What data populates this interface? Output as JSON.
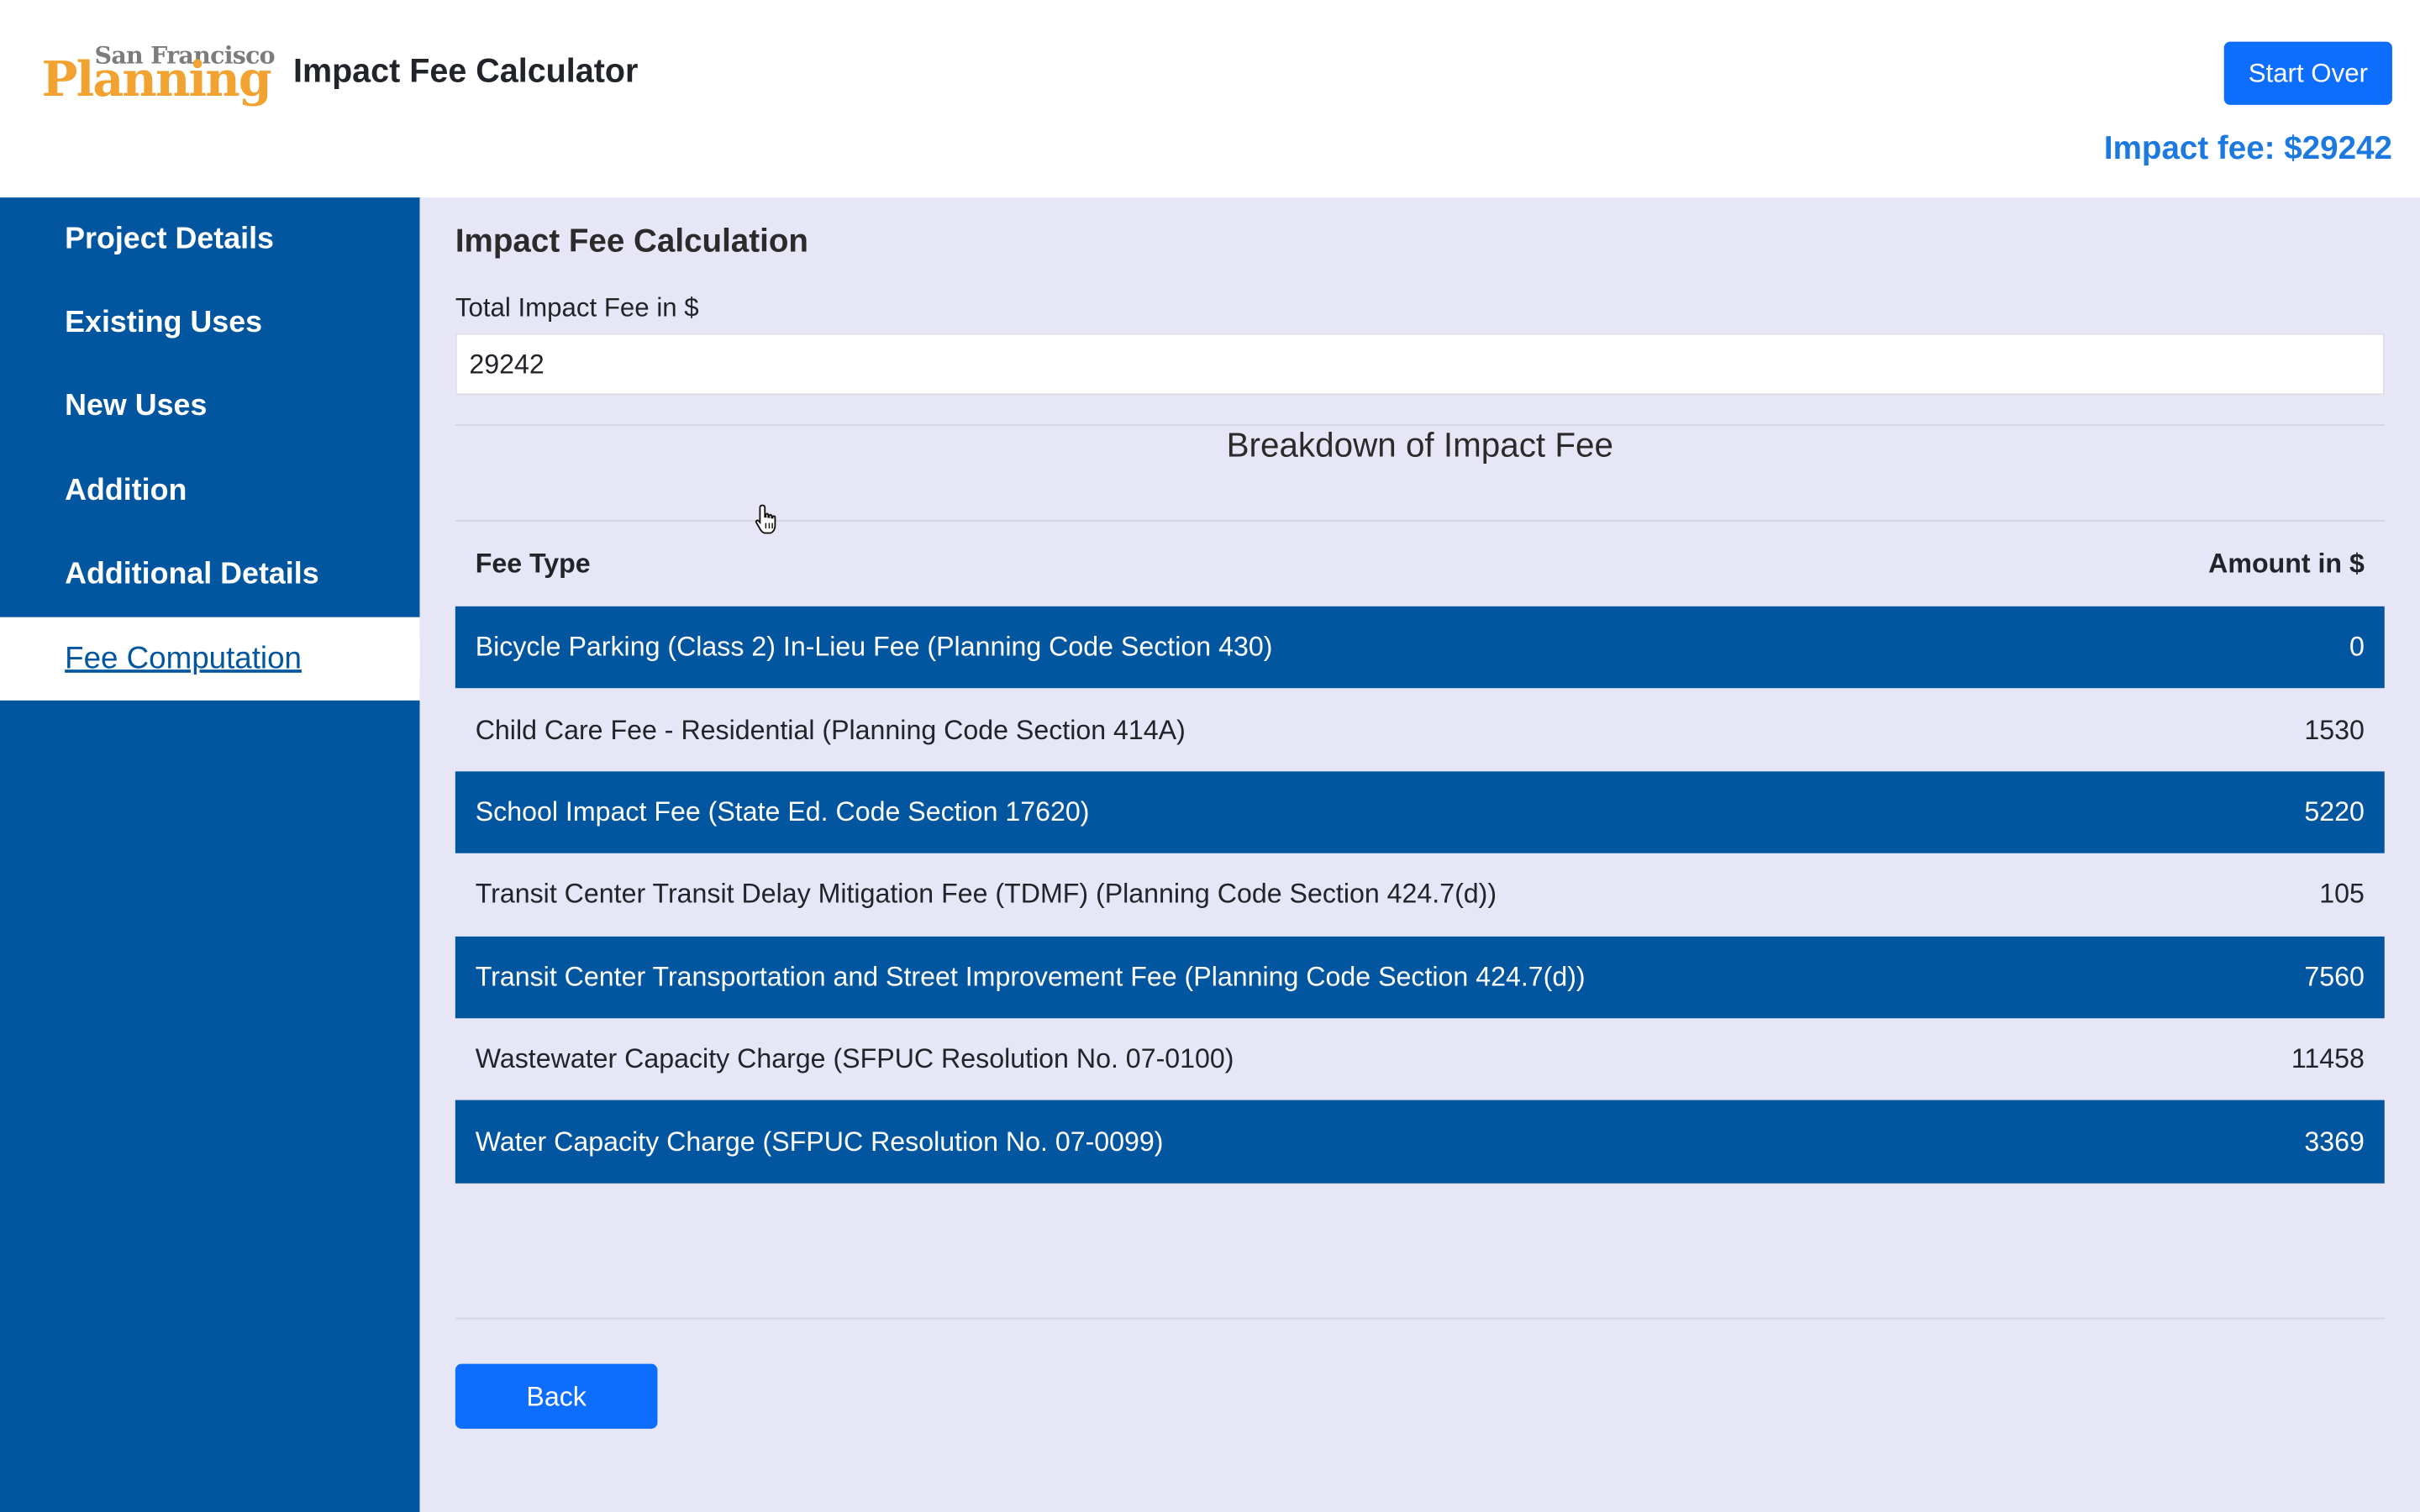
{
  "header": {
    "logo_top": "San Francisco",
    "logo_bottom": "Planning",
    "title": "Impact Fee Calculator",
    "start_over_label": "Start Over",
    "impact_fee_summary": "Impact fee: $29242"
  },
  "sidebar": {
    "items": [
      {
        "label": "Project Details",
        "active": false
      },
      {
        "label": "Existing Uses",
        "active": false
      },
      {
        "label": "New Uses",
        "active": false
      },
      {
        "label": "Addition",
        "active": false
      },
      {
        "label": "Additional Details",
        "active": false
      },
      {
        "label": "Fee Computation",
        "active": true
      }
    ]
  },
  "main": {
    "section_title": "Impact Fee Calculation",
    "total_label": "Total Impact Fee in $",
    "total_value": "29242",
    "breakdown_title": "Breakdown of Impact Fee",
    "table": {
      "headers": [
        "Fee Type",
        "Amount in $"
      ],
      "rows": [
        {
          "fee_type": "Bicycle Parking (Class 2) In-Lieu Fee (Planning Code Section 430)",
          "amount": "0"
        },
        {
          "fee_type": "Child Care Fee - Residential (Planning Code Section 414A)",
          "amount": "1530"
        },
        {
          "fee_type": "School Impact Fee (State Ed. Code Section 17620)",
          "amount": "5220"
        },
        {
          "fee_type": "Transit Center Transit Delay Mitigation Fee (TDMF) (Planning Code Section 424.7(d))",
          "amount": "105"
        },
        {
          "fee_type": "Transit Center Transportation and Street Improvement Fee (Planning Code Section 424.7(d))",
          "amount": "7560"
        },
        {
          "fee_type": "Wastewater Capacity Charge (SFPUC Resolution No. 07-0100)",
          "amount": "11458"
        },
        {
          "fee_type": "Water Capacity Charge (SFPUC Resolution No. 07-0099)",
          "amount": "3369"
        }
      ]
    },
    "back_label": "Back"
  },
  "colors": {
    "sidebar_bg": "#02569f",
    "main_bg": "#e6e6f7",
    "button_blue": "#0d6efd",
    "summary_blue": "#1b79df",
    "logo_orange": "#f2a230",
    "logo_gray": "#7c7c7c"
  },
  "icons": {
    "cursor": "hand-pointer-icon"
  }
}
